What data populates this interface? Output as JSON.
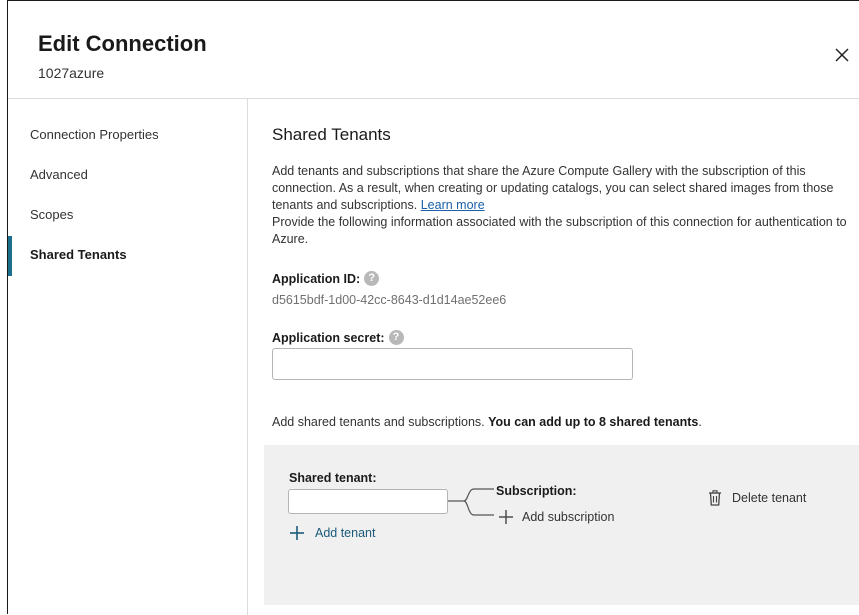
{
  "header": {
    "title": "Edit Connection",
    "subtitle": "1027azure",
    "close_icon": "close-icon"
  },
  "sidebar": {
    "items": [
      {
        "label": "Connection Properties",
        "active": false
      },
      {
        "label": "Advanced",
        "active": false
      },
      {
        "label": "Scopes",
        "active": false
      },
      {
        "label": "Shared Tenants",
        "active": true
      }
    ],
    "accent_color": "#1b6f8a"
  },
  "main": {
    "section_title": "Shared Tenants",
    "description_part1": "Add tenants and subscriptions that share the Azure Compute Gallery with the subscription of this connection. As a result, when creating or updating catalogs, you can select shared images from those tenants and subscriptions.",
    "learn_more": "Learn more",
    "description_part2": "Provide the following information associated with the subscription of this connection for authentication to Azure.",
    "application_id_label": "Application ID:",
    "application_id_value": "d5615bdf-1d00-42cc-8643-d1d14ae52ee6",
    "application_secret_label": "Application secret:",
    "application_secret_value": "",
    "add_note_prefix": "Add shared tenants and subscriptions.",
    "add_note_bold": "You can add up to 8 shared tenants",
    "add_note_suffix": "."
  },
  "tenant_panel": {
    "shared_tenant_label": "Shared tenant:",
    "shared_tenant_value": "",
    "subscription_label": "Subscription:",
    "add_subscription_label": "Add subscription",
    "add_tenant_label": "Add tenant",
    "delete_tenant_label": "Delete tenant"
  }
}
